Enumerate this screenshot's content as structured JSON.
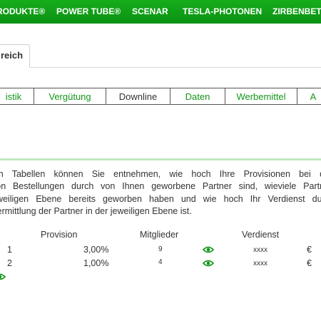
{
  "topnav": {
    "items": [
      "RODUKTE®",
      "POWER TUBE®",
      "SCENAR",
      "TESLA-PHOTONEN",
      "ZIRBENBETT"
    ]
  },
  "tabs": {
    "active_label": "reich"
  },
  "subtabs": [
    "istik",
    "Vergütung",
    "Downline",
    "Daten",
    "Werbemittel",
    "A"
  ],
  "intro": {
    "lines": [
      "len Tabellen können Sie entnehmen, wie hoch Ihre Provisionen bei de",
      "von Bestellungen durch von Ihnen geworbene Partner sind, wieviele Partne",
      "eweiligen Ebene bereits geworben haben und wie hoch Ihr Verdienst durc",
      "Vermittlung der Partner in der jeweiligen Ebene ist."
    ]
  },
  "table": {
    "headers": {
      "provision": "Provision",
      "mitglieder": "Mitglieder",
      "verdienst": "Verdienst"
    },
    "rows": [
      {
        "level": "1",
        "provision": "3,00%",
        "mitglieder": "9",
        "verdienst": "xxxx",
        "currency": "€"
      },
      {
        "level": "2",
        "provision": "1,00%",
        "mitglieder": "4",
        "verdienst": "xxxx",
        "currency": "€"
      }
    ]
  },
  "colors": {
    "brand_green": "#13961a",
    "nav_green": "#0f9e16",
    "divider": "#c2e6c3"
  },
  "icons": {
    "view": "eye-icon"
  }
}
